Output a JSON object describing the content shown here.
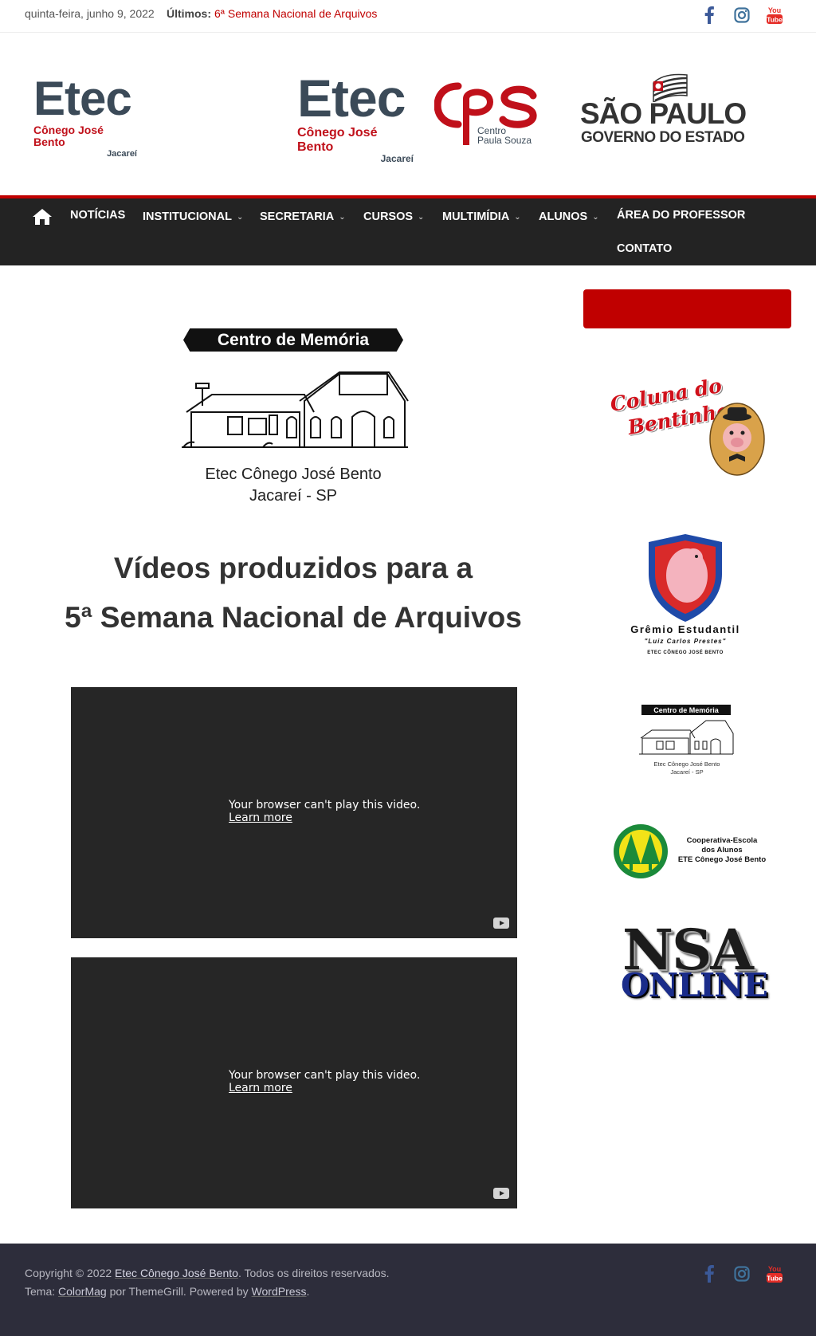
{
  "topbar": {
    "date": "quinta-feira, junho 9, 2022",
    "latest_label": "Últimos:",
    "latest_link": "6ª Semana Nacional de Arquivos",
    "social": [
      "facebook-icon",
      "instagram-icon",
      "youtube-icon"
    ]
  },
  "header": {
    "logo_left": {
      "title": "Etec",
      "subtitle": "Cônego José Bento",
      "city": "Jacareí"
    },
    "logo_center": {
      "title": "Etec",
      "subtitle": "Cônego José Bento",
      "city": "Jacareí"
    },
    "cps": {
      "line1": "Centro",
      "line2": "Paula Souza"
    },
    "sp": {
      "line1": "SÃO PAULO",
      "line2": "GOVERNO DO ESTADO"
    }
  },
  "nav": {
    "items": [
      {
        "label": "NOTÍCIAS",
        "dropdown": false
      },
      {
        "label": "INSTITUCIONAL",
        "dropdown": true
      },
      {
        "label": "SECRETARIA",
        "dropdown": true
      },
      {
        "label": "CURSOS",
        "dropdown": true
      },
      {
        "label": "MULTIMÍDIA",
        "dropdown": true
      },
      {
        "label": "ALUNOS",
        "dropdown": true
      },
      {
        "label": "ÁREA DO PROFESSOR",
        "dropdown": false
      },
      {
        "label": "CONTATO",
        "dropdown": false
      }
    ]
  },
  "main": {
    "memory_banner": "Centro de Memória",
    "memory_caption1": "Etec Cônego José Bento",
    "memory_caption2": "Jacareí - SP",
    "heading_line1": "Vídeos produzidos para a",
    "heading_line2": "5ª Semana Nacional de Arquivos",
    "videos": [
      {
        "message": "Your browser can't play this video.",
        "learn_more": "Learn more"
      },
      {
        "message": "Your browser can't play this video.",
        "learn_more": "Learn more"
      }
    ]
  },
  "sidebar": {
    "coluna": {
      "line1": "Coluna do",
      "line2": "Bentinho"
    },
    "gremio": {
      "line1": "Grêmio Estudantil",
      "line2": "\"Luiz Carlos Prestes\"",
      "line3": "ETEC CÔNEGO JOSÉ BENTO"
    },
    "memory_small": {
      "banner": "Centro de Memória",
      "caption1": "Etec Cônego José Bento",
      "caption2": "Jacareí - SP"
    },
    "coop": {
      "line1": "Cooperativa-Escola",
      "line2": "dos Alunos",
      "line3": "ETE Cônego José Bento"
    },
    "nsa": {
      "line1": "NSA",
      "line2": "ONLINE"
    }
  },
  "footer": {
    "copyright_prefix": "Copyright © 2022",
    "site_name": "Etec Cônego José Bento",
    "copyright_suffix": ". Todos os direitos reservados.",
    "theme_prefix": "Tema:",
    "theme_name": "ColorMag",
    "theme_by": "por ThemeGrill. Powered by",
    "wordpress": "WordPress",
    "period": "."
  },
  "colors": {
    "accent_red": "#c00000",
    "nav_bg": "#232323",
    "footer_bg": "#2d2d3b",
    "facebook": "#3b5998",
    "instagram": "#3f729b",
    "youtube": "#e52d27"
  }
}
